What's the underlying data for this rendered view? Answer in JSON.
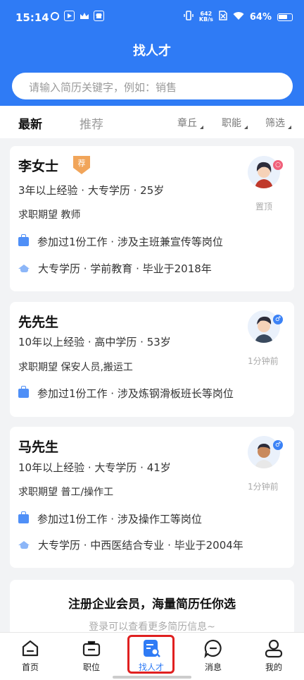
{
  "status_bar": {
    "time": "15:14",
    "net_speed": "642\nKB/s",
    "battery": "64%"
  },
  "header": {
    "title": "找人才"
  },
  "search": {
    "placeholder": "请输入简历关键字，例如：销售"
  },
  "tabs": [
    {
      "label": "最新"
    },
    {
      "label": "推荐"
    }
  ],
  "filters": [
    {
      "label": "章丘"
    },
    {
      "label": "职能"
    },
    {
      "label": "筛选"
    }
  ],
  "candidates": [
    {
      "name": "李女士",
      "badge": "荐",
      "meta": "3年以上经验 · 大专学历 · 25岁",
      "expect": "求职期望 教师",
      "work": "参加过1份工作 · 涉及主班兼宣传等岗位",
      "education": "大专学历 · 学前教育 · 毕业于2018年",
      "side_text": "置顶",
      "gender_color": "#f0607a"
    },
    {
      "name": "先先生",
      "meta": "10年以上经验 · 高中学历 · 53岁",
      "expect": "求职期望 保安人员,搬运工",
      "work": "参加过1份工作 · 涉及炼钢滑板班长等岗位",
      "side_text": "1分钟前",
      "gender_symbol": "♂",
      "gender_color": "#3b82f6"
    },
    {
      "name": "马先生",
      "meta": "10年以上经验 · 大专学历 · 41岁",
      "expect": "求职期望 普工/操作工",
      "work": "参加过1份工作 · 涉及操作工等岗位",
      "education": "大专学历 · 中西医结合专业 · 毕业于2004年",
      "side_text": "1分钟前",
      "gender_symbol": "♂",
      "gender_color": "#3b82f6"
    }
  ],
  "promo": {
    "title": "注册企业会员，海量简历任你选",
    "subtitle": "登录可以查看更多简历信息~"
  },
  "tabbar": [
    {
      "label": "首页"
    },
    {
      "label": "职位"
    },
    {
      "label": "找人才"
    },
    {
      "label": "消息"
    },
    {
      "label": "我的"
    }
  ],
  "colors": {
    "brand": "#2f7bf5",
    "highlight": "#e02020"
  }
}
